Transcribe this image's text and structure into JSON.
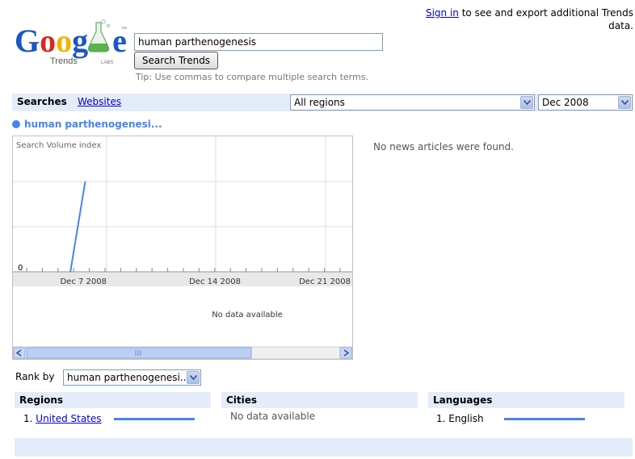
{
  "header": {
    "signin_link": "Sign in",
    "signin_rest": "to see and export additional Trends data.",
    "logo_text": "Google",
    "logo_sub": "Trends",
    "logo_labs": "LABS",
    "logo_tm": "™",
    "search_value": "human parthenogenesis",
    "search_button": "Search Trends",
    "tip": "Tip: Use commas to compare multiple search terms."
  },
  "tabs": {
    "searches": "Searches",
    "websites": "Websites",
    "region_selected": "All regions",
    "date_selected": "Dec 2008"
  },
  "term": {
    "label": "human parthenogenesi...",
    "color": "#4684ee"
  },
  "chart_data": {
    "type": "line",
    "ylabel": "Search Volume index",
    "y_tick": "0",
    "x_ticks": [
      "Dec 7 2008",
      "Dec 14 2008",
      "Dec 21 2008"
    ],
    "series": [
      {
        "name": "human parthenogenesi...",
        "color": "#4684ee",
        "values": [
          0,
          100
        ]
      }
    ],
    "x_days": [
      4.0,
      5.0
    ],
    "x_axis_start_day": 1,
    "x_axis_end_day": 23,
    "no_data_text": "No data available"
  },
  "news": {
    "empty_text": "No news articles were found."
  },
  "rank_by": {
    "label": "Rank by",
    "selected": "human parthenogenesi..."
  },
  "sections": {
    "regions": {
      "title": "Regions",
      "items": [
        {
          "rank": "1.",
          "name": "United States",
          "share": 1.0
        }
      ]
    },
    "cities": {
      "title": "Cities",
      "empty_text": "No data available"
    },
    "languages": {
      "title": "Languages",
      "items": [
        {
          "rank": "1.",
          "name": "English",
          "share": 1.0
        }
      ]
    }
  },
  "colors": {
    "accent": "#4684ee",
    "panel": "#e5ecf9",
    "link": "#0000cc"
  }
}
